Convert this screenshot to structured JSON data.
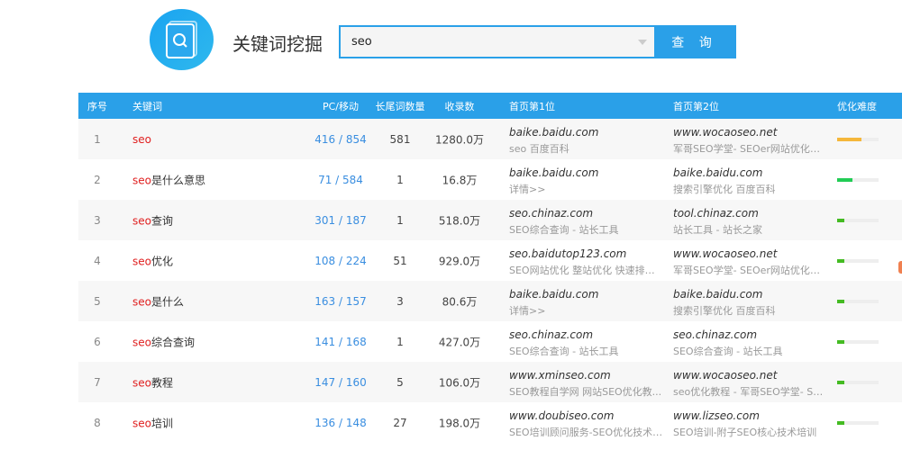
{
  "header": {
    "title": "关键词挖掘",
    "search_value": "seo",
    "search_button": "查 询"
  },
  "columns": [
    "序号",
    "关键词",
    "PC/移动",
    "长尾词数量",
    "收录数",
    "首页第1位",
    "首页第2位",
    "优化难度"
  ],
  "rows": [
    {
      "no": "1",
      "kw": "seo",
      "kw_rest": "",
      "pc": "416 / 854",
      "long": "581",
      "idx": "1280.0万",
      "s1": "baike.baidu.com",
      "d1": "seo 百度百科",
      "s2": "www.wocaoseo.net",
      "d2": "军哥SEO学堂- SEOer网站优化排...",
      "difficulty": 58,
      "color": "#f5b73b"
    },
    {
      "no": "2",
      "kw": "seo",
      "kw_rest": "是什么意思",
      "pc": "71 / 584",
      "long": "1",
      "idx": "16.8万",
      "s1": "baike.baidu.com",
      "d1": "详情>>",
      "s2": "baike.baidu.com",
      "d2": "搜索引擎优化 百度百科",
      "difficulty": 38,
      "color": "#22cc55"
    },
    {
      "no": "3",
      "kw": "seo",
      "kw_rest": "查询",
      "pc": "301 / 187",
      "long": "1",
      "idx": "518.0万",
      "s1": "seo.chinaz.com",
      "d1": "SEO综合查询 - 站长工具",
      "s2": "tool.chinaz.com",
      "d2": "站长工具 - 站长之家",
      "difficulty": 18,
      "color": "#44bb22"
    },
    {
      "no": "4",
      "kw": "seo",
      "kw_rest": "优化",
      "pc": "108 / 224",
      "long": "51",
      "idx": "929.0万",
      "s1": "seo.baidutop123.com",
      "d1": "SEO网站优化 整站优化 快速排名...",
      "s2": "www.wocaoseo.net",
      "d2": "军哥SEO学堂- SEOer网站优化排...",
      "difficulty": 18,
      "color": "#44bb22"
    },
    {
      "no": "5",
      "kw": "seo",
      "kw_rest": "是什么",
      "pc": "163 / 157",
      "long": "3",
      "idx": "80.6万",
      "s1": "baike.baidu.com",
      "d1": "详情>>",
      "s2": "baike.baidu.com",
      "d2": "搜索引擎优化 百度百科",
      "difficulty": 18,
      "color": "#44bb22"
    },
    {
      "no": "6",
      "kw": "seo",
      "kw_rest": "综合查询",
      "pc": "141 / 168",
      "long": "1",
      "idx": "427.0万",
      "s1": "seo.chinaz.com",
      "d1": "SEO综合查询 - 站长工具",
      "s2": "seo.chinaz.com",
      "d2": "SEO综合查询 - 站长工具",
      "difficulty": 18,
      "color": "#44bb22"
    },
    {
      "no": "7",
      "kw": "seo",
      "kw_rest": "教程",
      "pc": "147 / 160",
      "long": "5",
      "idx": "106.0万",
      "s1": "www.xminseo.com",
      "d1": "SEO教程自学网 网站SEO优化教...",
      "s2": "www.wocaoseo.net",
      "d2": "seo优化教程 - 军哥SEO学堂- SEO...",
      "difficulty": 18,
      "color": "#44bb22"
    },
    {
      "no": "8",
      "kw": "seo",
      "kw_rest": "培训",
      "pc": "136 / 148",
      "long": "27",
      "idx": "198.0万",
      "s1": "www.doubiseo.com",
      "d1": "SEO培训顾问服务-SEO优化技术教...",
      "s2": "www.lizseo.com",
      "d2": "SEO培训-附子SEO核心技术培训",
      "difficulty": 18,
      "color": "#44bb22"
    }
  ]
}
